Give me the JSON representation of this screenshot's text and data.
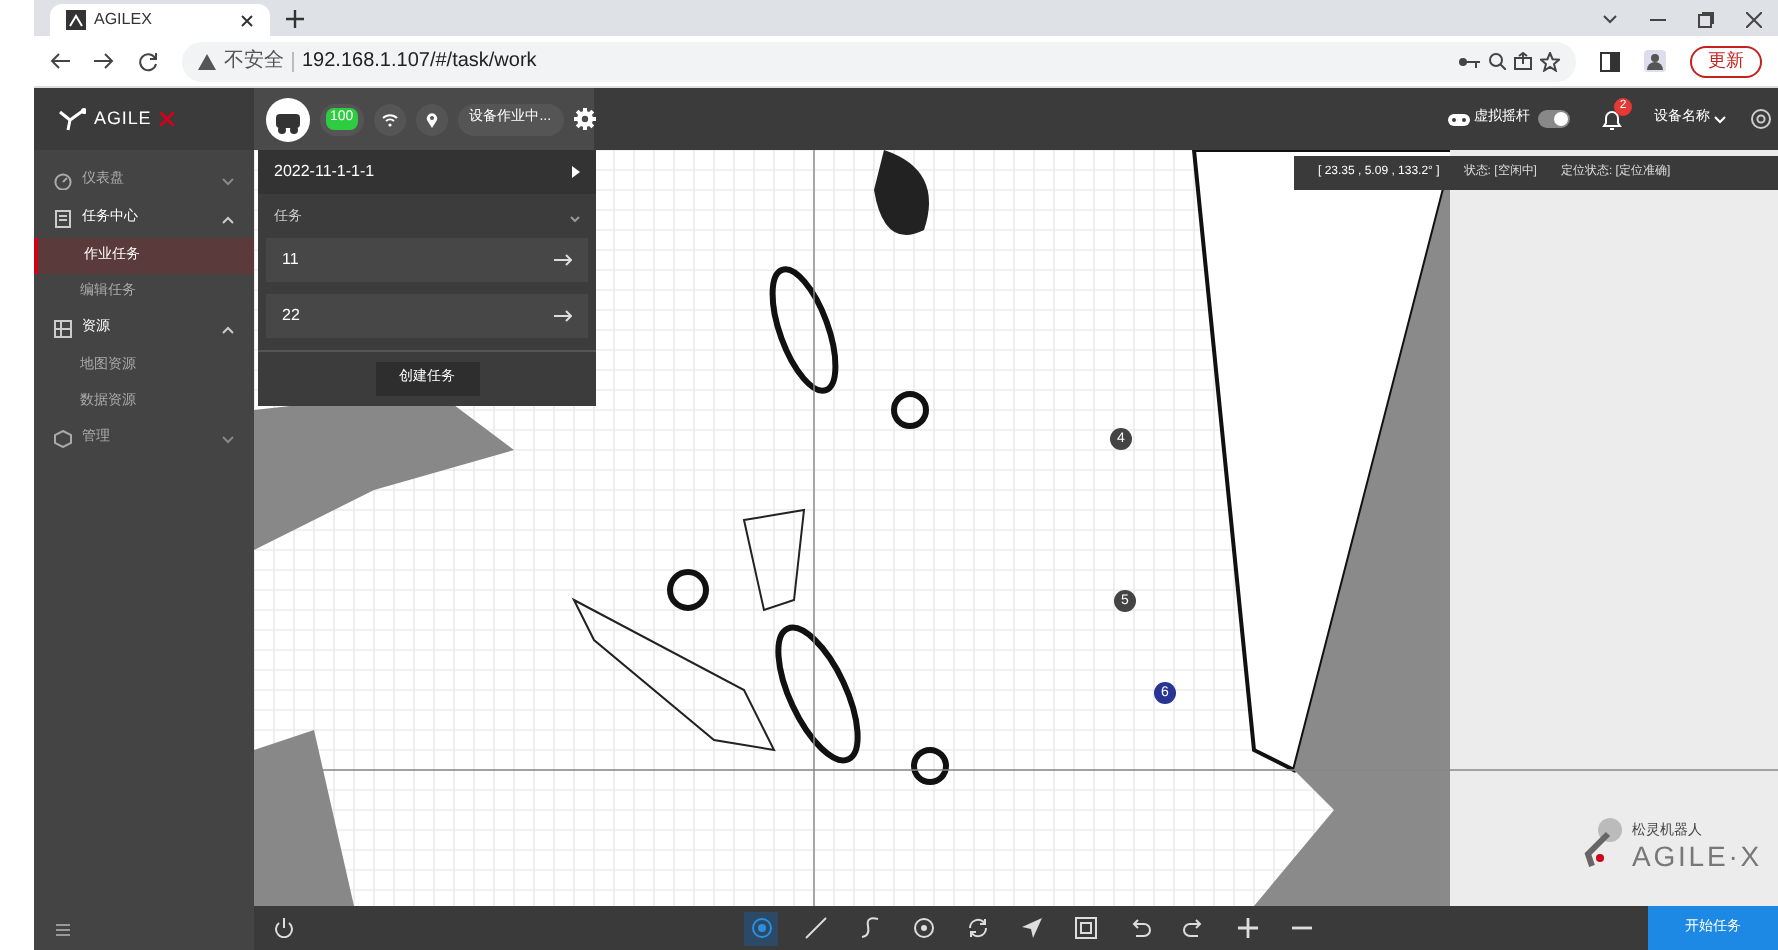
{
  "browser": {
    "tab_title": "AGILEX",
    "security_label": "不安全",
    "url": "192.168.1.107/#/task/work",
    "update_button": "更新"
  },
  "header": {
    "logo": "AGILE",
    "battery": "100",
    "device_status": "设备作业中...",
    "joystick_label": "虚拟摇杆",
    "joystick_on": true,
    "notification_count": "2",
    "device_name": "设备名称"
  },
  "sidebar": {
    "items": [
      {
        "label": "仪表盘",
        "expanded": false
      },
      {
        "label": "任务中心",
        "expanded": true,
        "children": [
          {
            "label": "作业任务",
            "selected": true
          },
          {
            "label": "编辑任务",
            "selected": false
          }
        ]
      },
      {
        "label": "资源",
        "expanded": true,
        "children": [
          {
            "label": "地图资源",
            "selected": false
          },
          {
            "label": "数据资源",
            "selected": false
          }
        ]
      },
      {
        "label": "管理",
        "expanded": false
      }
    ]
  },
  "task_panel": {
    "map_name": "2022-11-1-1-1",
    "section": "任务",
    "tasks": [
      "11",
      "22"
    ],
    "create_button": "创建任务"
  },
  "status": {
    "pose": "[ 23.35 , 5.09 , 133.2° ]",
    "state": "状态: [空闲中]",
    "localization": "定位状态: [定位准确]"
  },
  "markers": [
    {
      "label": "4"
    },
    {
      "label": "5"
    },
    {
      "label": "6"
    }
  ],
  "tools": [
    {
      "kind": "target",
      "selected": true
    },
    {
      "kind": "line",
      "selected": false
    },
    {
      "kind": "curve",
      "selected": false
    },
    {
      "kind": "point",
      "selected": false
    },
    {
      "kind": "refresh",
      "selected": false
    },
    {
      "kind": "navigate",
      "selected": false
    },
    {
      "kind": "fit",
      "selected": false
    },
    {
      "kind": "undo",
      "selected": false
    },
    {
      "kind": "redo",
      "selected": false
    },
    {
      "kind": "zoom-in",
      "selected": false
    },
    {
      "kind": "zoom-out",
      "selected": false
    }
  ],
  "start_button": "开始任务",
  "brand": {
    "tagline": "松灵机器人",
    "name": "AGILE·X"
  }
}
